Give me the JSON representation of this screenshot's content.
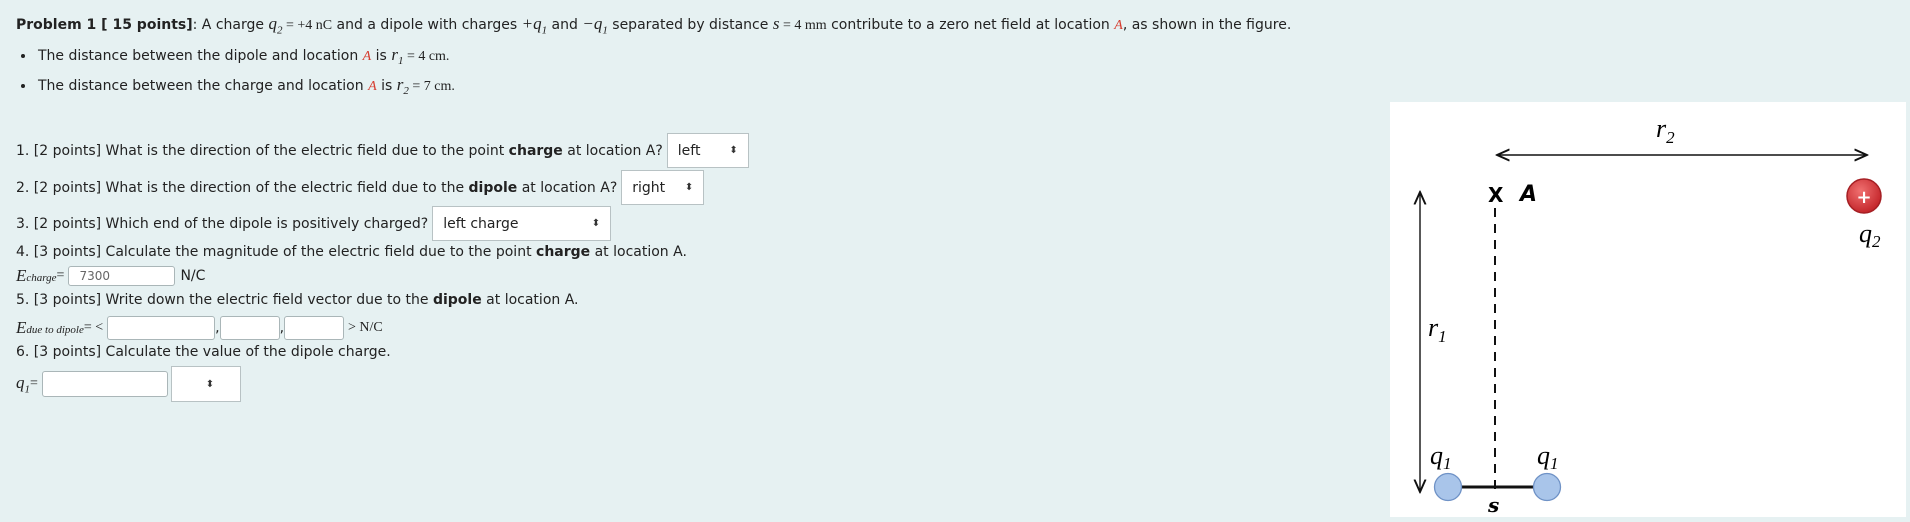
{
  "problem": {
    "label": "Problem 1 [ 15 points]",
    "intro_1": ": A charge ",
    "q2": "q",
    "q2_sub": "2",
    "eq_q2": " = +4 nC",
    "intro_2": " and a dipole with charges ",
    "plus_q1": "+q",
    "plus_q1_sub": "1",
    "and": "  and ",
    "minus_q1": "−q",
    "minus_q1_sub": "1",
    "intro_3": " separated by distance ",
    "s": "s",
    "eq_s": " = 4 mm",
    "intro_4": " contribute to a zero net field at location ",
    "A": "A",
    "intro_5": ", as shown in the figure."
  },
  "bullets": [
    {
      "pre": "The distance between the dipole and location ",
      "A": "A",
      "mid": " is ",
      "var": "r",
      "sub": "1",
      "eq": " = 4 cm."
    },
    {
      "pre": "The distance between the charge and location ",
      "A": "A",
      "mid": " is ",
      "var": "r",
      "sub": "2",
      "eq": " = 7 cm."
    }
  ],
  "questions": {
    "q1": {
      "pre": "1. [2 points] What is the direction of the electric field due to the point ",
      "bold": "charge",
      "post": " at location A?",
      "selected": "left"
    },
    "q2": {
      "pre": "2. [2 points] What is the direction of the electric field due to the ",
      "bold": "dipole",
      "post": " at location A?",
      "selected": "right"
    },
    "q3": {
      "pre": "3. [2 points] Which end of the dipole is positively charged?",
      "selected": "left charge"
    },
    "q4": {
      "pre": "4. [3 points] Calculate the magnitude of the electric field due to the point ",
      "bold": "charge",
      "post": " at location A.",
      "var": "E",
      "sub": "charge",
      "eq": " =",
      "value": "7300",
      "unit": "N/C"
    },
    "q5": {
      "pre": "5. [3 points] Write down the electric field vector due to the ",
      "bold": "dipole",
      "post": " at location A.",
      "var": "E",
      "sub": "due to dipole",
      "eq": " =  <",
      "comma": ",",
      "close": "> N/C",
      "x": "",
      "y": "",
      "z": ""
    },
    "q6": {
      "pre": "6. [3 points] Calculate the value of the dipole charge.",
      "var": "q",
      "sub": "1",
      "eq": " =",
      "value": "",
      "unit_selected": ""
    }
  },
  "figure": {
    "r2_label": "r",
    "r2_sub": "2",
    "x_mark": "X",
    "A_label": "A",
    "plus_sign": "+",
    "q2_label": "q",
    "q2_sub": "2",
    "r1_label": "r",
    "r1_sub": "1",
    "q1_left": "q",
    "q1_left_sub": "1",
    "q1_right": "q",
    "q1_right_sub": "1",
    "s_label": "s",
    "colors": {
      "charge_red": "#d8373a",
      "dipole_blue": "#a9c5ea",
      "label_red": "#d63d30"
    }
  }
}
